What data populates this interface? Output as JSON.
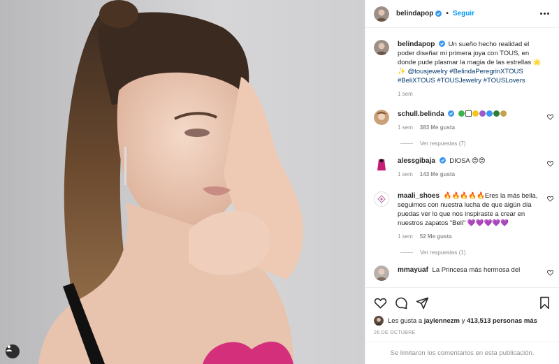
{
  "post": {
    "author": "belindapop",
    "follow_label": "Seguir",
    "dot": "•"
  },
  "caption": {
    "username": "belindapop",
    "text": "Un sueño hecho realidad el poder diseñar mi primera joya con TOUS, en donde pude plasmar la magia de las estrellas 🌟 ✨",
    "tags": "@tousjewelry #BelindaPeregrinXTOUS #BeliXTOUS #TOUSJewelry #TOUSLovers",
    "time": "1 sem"
  },
  "comments": [
    {
      "username": "schull.belinda",
      "text": "",
      "time": "1 sem",
      "likes": "383 Me gusta",
      "replies": "Ver respuestas (7)"
    },
    {
      "username": "alessgibaja",
      "text": "DIOSA 😍😍",
      "time": "1 sem",
      "likes": "143 Me gusta"
    },
    {
      "username": "maali_shoes",
      "text": "🔥🔥🔥🔥🔥Eres la más bella, seguimos con nuestra lucha de que algún día puedas ver lo que nos inspiraste a crear en nuestros zapatos “Beli” 💜💜💜💜💜",
      "time": "1 sem",
      "likes": "52 Me gusta",
      "replies": "Ver respuestas (1)"
    },
    {
      "username": "mmayuaf",
      "text": "La Princesa más hermosa del"
    }
  ],
  "likes_line": {
    "prefix": "Les gusta a",
    "user": "jaylennezm",
    "joiner": "y",
    "count": "413,513 personas más"
  },
  "date": "26 DE OCTUBRE",
  "comments_limited": "Se limitaron los comentarios en esta publicación.",
  "colors": {
    "accent": "#0095f6",
    "verified": "#3897f0",
    "muted": "#8e8e8e",
    "text": "#262626"
  },
  "icons": [
    "heart-icon",
    "comment-icon",
    "share-icon",
    "bookmark-icon",
    "verified-icon",
    "more-icon",
    "user-tag-icon"
  ]
}
